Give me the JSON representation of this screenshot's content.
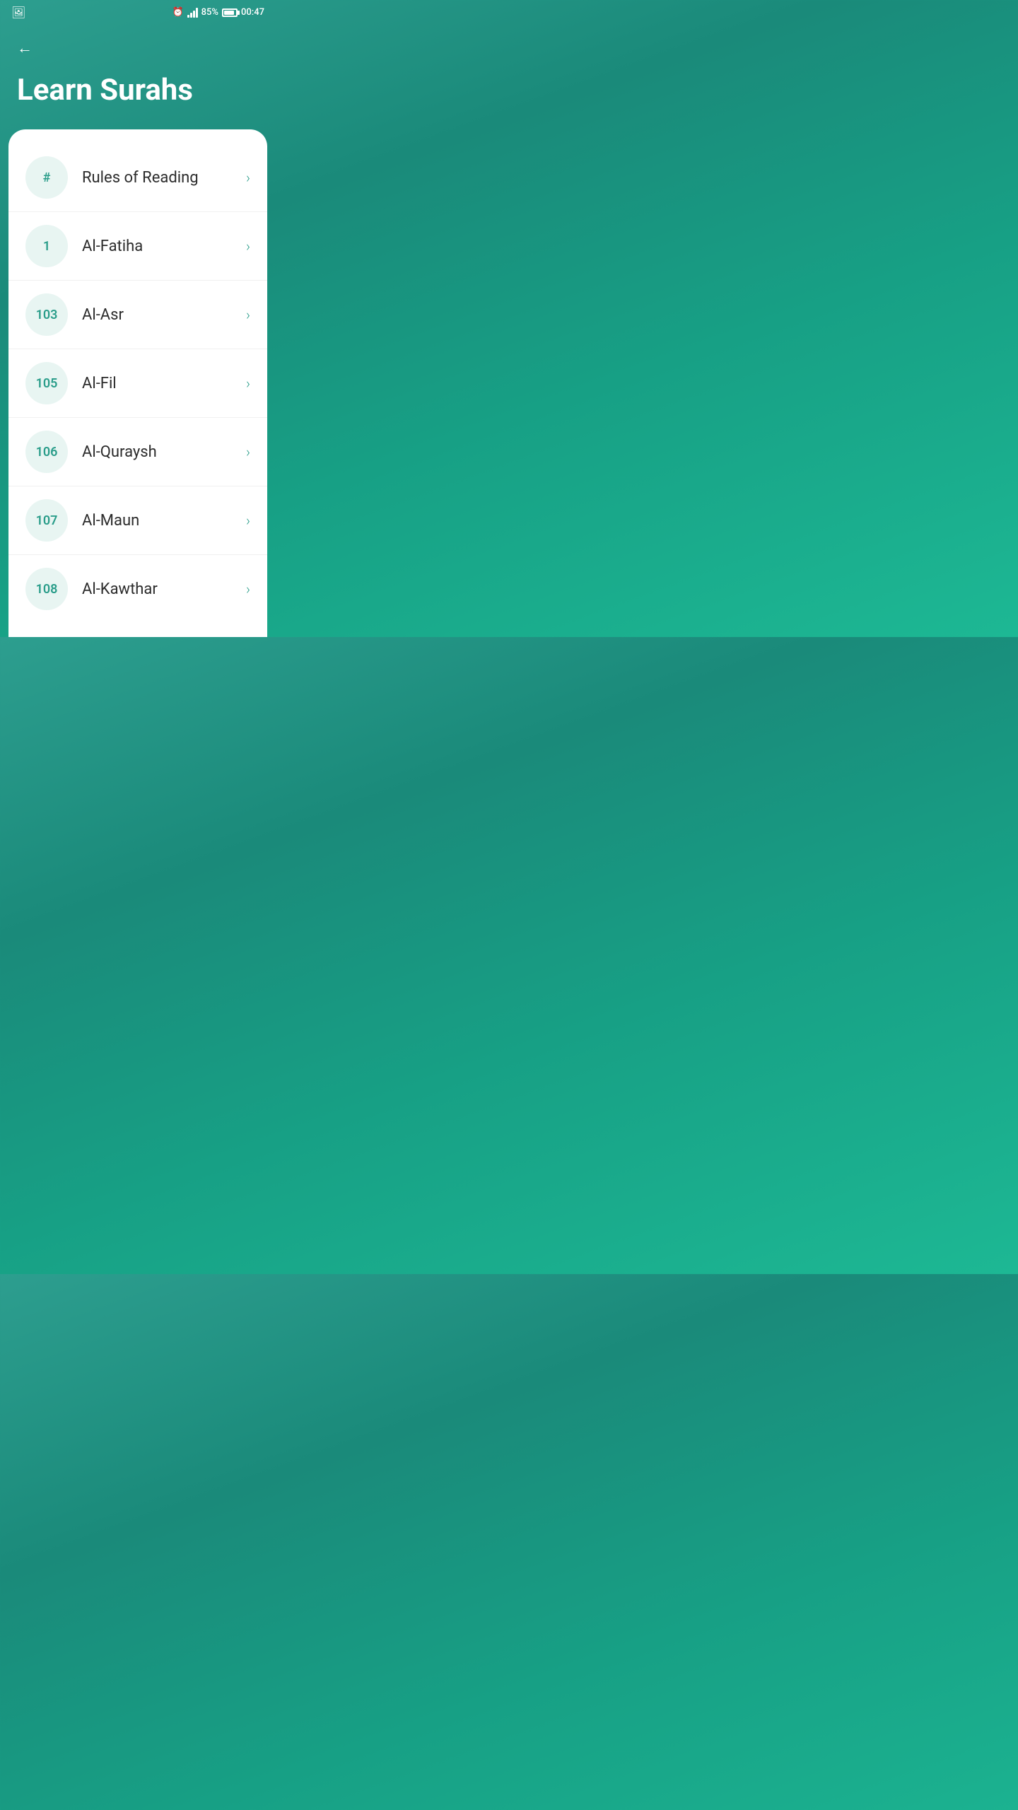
{
  "statusBar": {
    "time": "00:47",
    "battery": "85%",
    "alarm": "⏰"
  },
  "header": {
    "backLabel": "←",
    "title": "Learn Surahs"
  },
  "items": [
    {
      "id": "rules",
      "badge": "#",
      "name": "Rules of Reading"
    },
    {
      "id": "al-fatiha",
      "badge": "1",
      "name": "Al-Fatiha"
    },
    {
      "id": "al-asr",
      "badge": "103",
      "name": "Al-Asr"
    },
    {
      "id": "al-fil",
      "badge": "105",
      "name": "Al-Fil"
    },
    {
      "id": "al-quraysh",
      "badge": "106",
      "name": "Al-Quraysh"
    },
    {
      "id": "al-maun",
      "badge": "107",
      "name": "Al-Maun"
    },
    {
      "id": "al-kawthar",
      "badge": "108",
      "name": "Al-Kawthar"
    }
  ],
  "chevron": "›"
}
